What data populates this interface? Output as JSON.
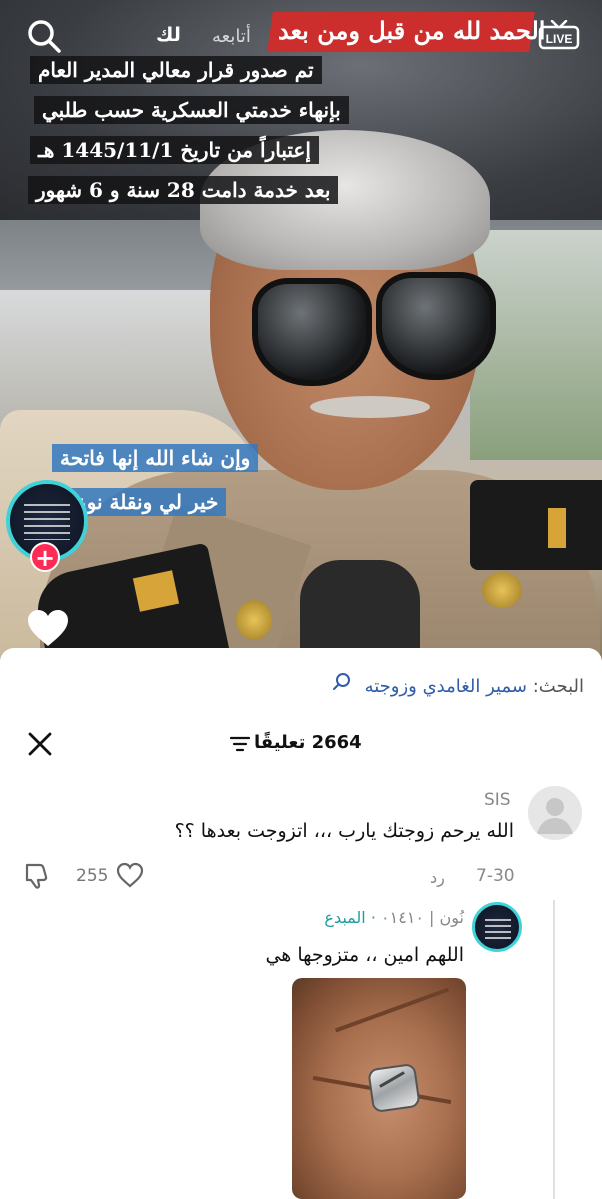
{
  "video": {
    "banner_text": "الحمد لله من قبل ومن بعد",
    "caption_lines": [
      "تم صدور قرار معالي المدير العام",
      "بإنهاء خدمتي العسكرية حسب طلبي",
      "إعتباراً من تاريخ 1445/11/1 هـ",
      "بعد خدمة دامت 28 سنة و 6 شهور"
    ],
    "caption_blue_lines": [
      "وإن شاء الله إنها فاتحة",
      "خير لي ونقلة نوعية"
    ],
    "top_tabs": {
      "following": "أتابعه",
      "for_you": "لك"
    },
    "live_label": "LIVE"
  },
  "comments": {
    "search_hint": {
      "label": "البحث:",
      "term": "سمير الغامدي وزوجته"
    },
    "count_label": "2664 تعليقًا",
    "items": [
      {
        "username": "SIS",
        "text": "الله يرحم زوجتك يارب ،،، اتزوجت بعدها ؟؟",
        "date": "7-30",
        "reply_label": "رد",
        "likes": "255"
      }
    ],
    "reply": {
      "username": "نُون | ٠١٤١٠",
      "badge": "المبدع",
      "text": "اللهم امين ،، متزوجها هي"
    }
  },
  "icons": {
    "accent_teal": "#3fd2d8",
    "accent_red": "#fe2c55",
    "banner_red": "#cc2d2d"
  }
}
